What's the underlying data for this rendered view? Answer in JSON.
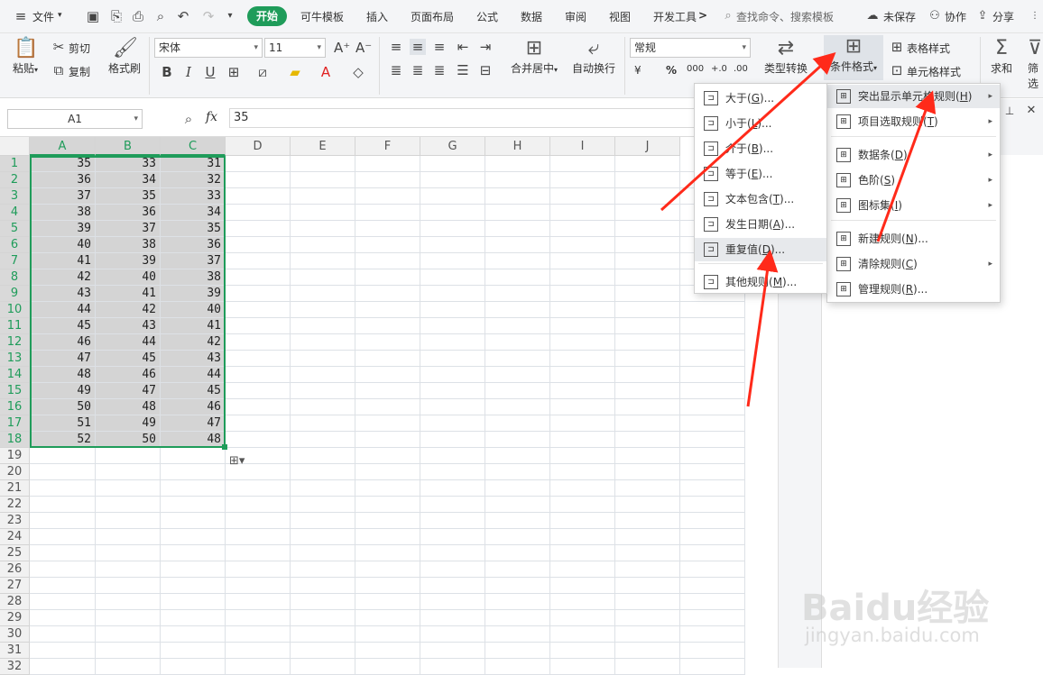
{
  "menubar": {
    "file": "文件",
    "file_arrow": "▾",
    "tabs": [
      "开始",
      "可牛模板",
      "插入",
      "页面布局",
      "公式",
      "数据",
      "审阅",
      "视图",
      "开发工具"
    ],
    "more": ">",
    "search": "查找命令、搜索模板",
    "unsaved": "未保存",
    "collab": "协作",
    "share": "分享"
  },
  "ribbon": {
    "paste": "粘贴",
    "cut": "剪切",
    "copy": "复制",
    "format_painter": "格式刷",
    "font_name": "宋体",
    "font_size": "11",
    "merge_center": "合并居中",
    "wrap_text": "自动换行",
    "number_format": "常规",
    "currency": "¥",
    "percent": "%",
    "thousands": "000",
    "inc_decimal": "+.0",
    "dec_decimal": ".00",
    "type_convert": "类型转换",
    "cond_format": "条件格式",
    "table_style": "表格样式",
    "cell_style": "单元格样式",
    "sum": "求和",
    "filter": "筛选"
  },
  "formula_bar": {
    "cell_ref": "A1",
    "fx": "fx",
    "value": "35"
  },
  "grid": {
    "columns": [
      "A",
      "B",
      "C",
      "D",
      "E",
      "F",
      "G",
      "H",
      "I",
      "J"
    ],
    "rows": [
      "1",
      "2",
      "3",
      "4",
      "5",
      "6",
      "7",
      "8",
      "9",
      "10",
      "11",
      "12",
      "13",
      "14",
      "15",
      "16",
      "17",
      "18",
      "19",
      "20",
      "21",
      "22",
      "23",
      "24",
      "25",
      "26",
      "27",
      "28",
      "29",
      "30",
      "31",
      "32"
    ],
    "data": [
      [
        "35",
        "33",
        "31"
      ],
      [
        "36",
        "34",
        "32"
      ],
      [
        "37",
        "35",
        "33"
      ],
      [
        "38",
        "36",
        "34"
      ],
      [
        "39",
        "37",
        "35"
      ],
      [
        "40",
        "38",
        "36"
      ],
      [
        "41",
        "39",
        "37"
      ],
      [
        "42",
        "40",
        "38"
      ],
      [
        "43",
        "41",
        "39"
      ],
      [
        "44",
        "42",
        "40"
      ],
      [
        "45",
        "43",
        "41"
      ],
      [
        "46",
        "44",
        "42"
      ],
      [
        "47",
        "45",
        "43"
      ],
      [
        "48",
        "46",
        "44"
      ],
      [
        "49",
        "47",
        "45"
      ],
      [
        "50",
        "48",
        "46"
      ],
      [
        "51",
        "49",
        "47"
      ],
      [
        "52",
        "50",
        "48"
      ]
    ]
  },
  "cond_menu": {
    "items": [
      {
        "label": "突出显示单元格规则(",
        "key": "H",
        ")": "",
        "tail": ")",
        "submenu": true
      },
      {
        "label": "项目选取规则(",
        "key": "T",
        "tail": ")",
        "submenu": true
      },
      {
        "label": "数据条(",
        "key": "D",
        "tail": ")",
        "submenu": true
      },
      {
        "label": "色阶(",
        "key": "S",
        "tail": ")",
        "submenu": true
      },
      {
        "label": "图标集(",
        "key": "I",
        "tail": ")",
        "submenu": true
      },
      {
        "label": "新建规则(",
        "key": "N",
        "tail": ")...",
        "submenu": false
      },
      {
        "label": "清除规则(",
        "key": "C",
        "tail": ")",
        "submenu": true
      },
      {
        "label": "管理规则(",
        "key": "R",
        "tail": ")...",
        "submenu": false
      }
    ]
  },
  "highlight_menu": {
    "items": [
      {
        "label": "大于(",
        "key": "G",
        "tail": ")..."
      },
      {
        "label": "小于(",
        "key": "L",
        "tail": ")..."
      },
      {
        "label": "介于(",
        "key": "B",
        "tail": ")..."
      },
      {
        "label": "等于(",
        "key": "E",
        "tail": ")..."
      },
      {
        "label": "文本包含(",
        "key": "T",
        "tail": ")..."
      },
      {
        "label": "发生日期(",
        "key": "A",
        "tail": ")..."
      },
      {
        "label": "重复值(",
        "key": "D",
        "tail": ")..."
      },
      {
        "label": "其他规则(",
        "key": "M",
        "tail": ")..."
      }
    ]
  },
  "watermark": {
    "main": "Baidu经验",
    "sub": "jingyan.baidu.com"
  },
  "colors": {
    "accent": "#1f9c5a",
    "arrow": "#ff2a1a",
    "selection": "#d4d4d4"
  }
}
